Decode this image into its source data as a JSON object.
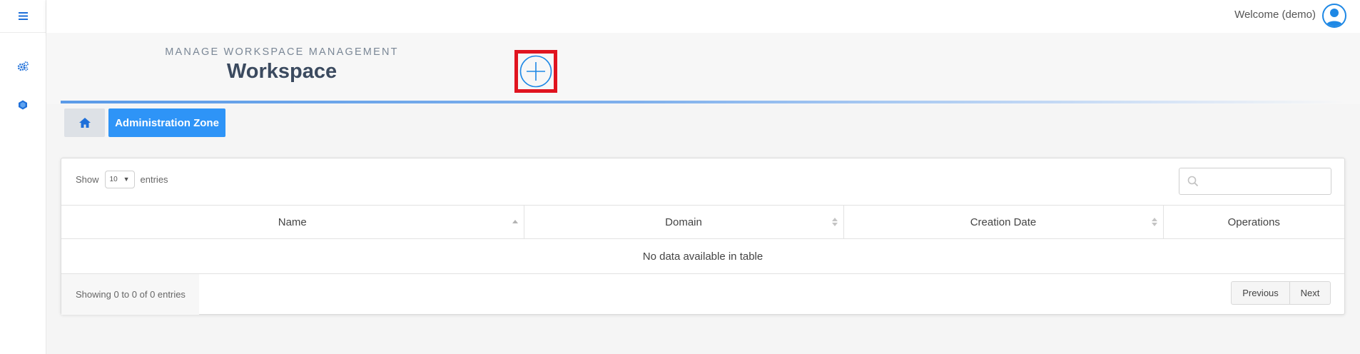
{
  "header": {
    "welcome": "Welcome (demo)"
  },
  "sidebar": {
    "items": [
      {
        "icon": "gears-icon"
      },
      {
        "icon": "cube-icon"
      }
    ]
  },
  "page": {
    "subtitle": "MANAGE WORKSPACE MANAGEMENT",
    "title": "Workspace"
  },
  "breadcrumb": {
    "zone": "Administration Zone"
  },
  "table": {
    "show_label": "Show",
    "entries_label": "entries",
    "page_length": "10",
    "search_value": "",
    "columns": [
      "Name",
      "Domain",
      "Creation Date",
      "Operations"
    ],
    "empty": "No data available in table",
    "info": "Showing 0 to 0 of 0 entries",
    "prev": "Previous",
    "next": "Next"
  },
  "colors": {
    "accent": "#2e94f7",
    "highlight": "#e0141f",
    "title": "#3b4a5f"
  }
}
